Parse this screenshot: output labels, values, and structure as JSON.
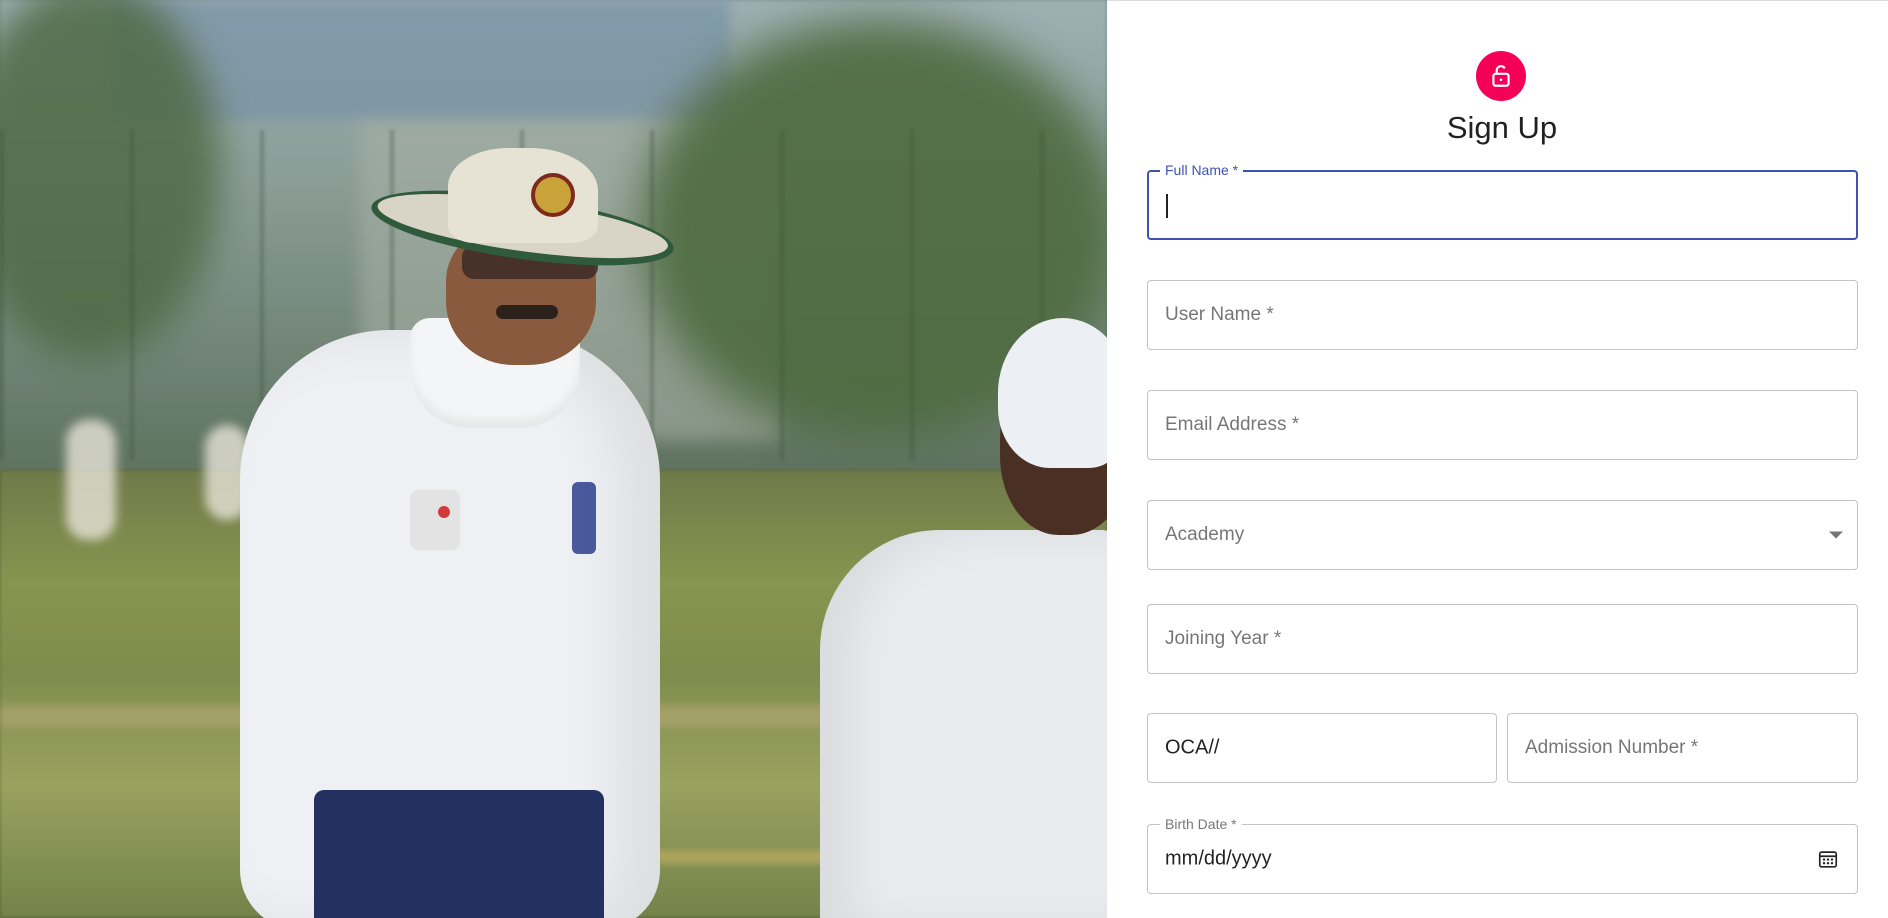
{
  "form": {
    "title": "Sign Up",
    "accent_color": "#f50057",
    "focus_color": "#3f51b5",
    "avatar_icon": "lock-open-icon",
    "full_name": {
      "label": "Full Name *",
      "value": ""
    },
    "user_name": {
      "placeholder": "User Name *"
    },
    "email": {
      "placeholder": "Email Address *"
    },
    "academy": {
      "placeholder": "Academy",
      "icon": "chevron-down-icon"
    },
    "joining_year": {
      "placeholder": "Joining Year *"
    },
    "admission_prefix": {
      "value": "OCA//"
    },
    "admission_number": {
      "placeholder": "Admission Number *"
    },
    "birth_date": {
      "label": "Birth Date *",
      "value": "mm/dd/yyyy",
      "icon": "calendar-icon"
    }
  },
  "hero": {
    "image": "cricket-coach-photo"
  }
}
